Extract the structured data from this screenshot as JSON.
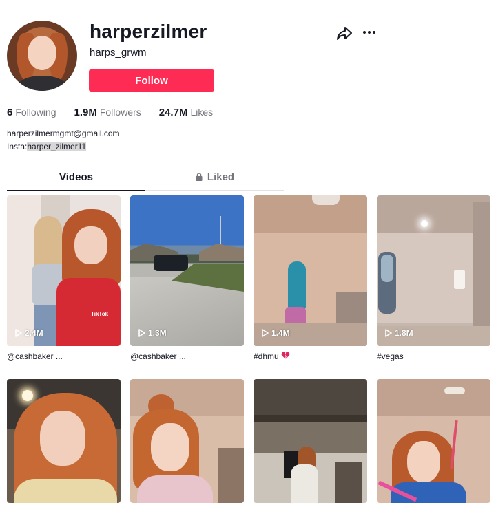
{
  "profile": {
    "username": "harperzilmer",
    "nickname": "harps_grwm",
    "follow_label": "Follow",
    "stats": [
      {
        "value": "6",
        "label": "Following"
      },
      {
        "value": "1.9M",
        "label": "Followers"
      },
      {
        "value": "24.7M",
        "label": "Likes"
      }
    ],
    "bio_line1": "harperzilmermgmt@gmail.com",
    "bio_line2_prefix": "Insta:",
    "bio_line2_handle": "harper_zilmer11"
  },
  "tabs": [
    {
      "label": "Videos",
      "active": true
    },
    {
      "label": "Liked",
      "active": false,
      "icon": "lock-icon"
    }
  ],
  "videos": [
    {
      "views": "2.4M",
      "caption": "@cashbaker ..."
    },
    {
      "views": "1.3M",
      "caption": "@cashbaker ..."
    },
    {
      "views": "1.4M",
      "caption": "#dhmu",
      "caption_icon": "broken-heart-icon"
    },
    {
      "views": "1.8M",
      "caption": "#vegas"
    },
    {
      "views": "",
      "caption": ""
    },
    {
      "views": "",
      "caption": ""
    },
    {
      "views": "",
      "caption": ""
    },
    {
      "views": "",
      "caption": ""
    }
  ],
  "thumb_watermark": "TikTok",
  "colors": {
    "accent": "#fe2c55",
    "text": "#161823",
    "muted": "#75767c"
  }
}
